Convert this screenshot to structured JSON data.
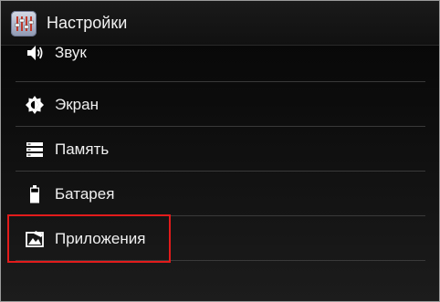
{
  "header": {
    "app_icon": "settings-equalizer-icon",
    "title": "Настройки"
  },
  "settings_list": [
    {
      "label": "Звук",
      "icon": "volume-speaker-icon"
    },
    {
      "label": "Экран",
      "icon": "brightness-icon"
    },
    {
      "label": "Память",
      "icon": "storage-icon"
    },
    {
      "label": "Батарея",
      "icon": "battery-icon"
    },
    {
      "label": "Приложения",
      "icon": "applications-icon"
    }
  ],
  "colors": {
    "background": "#000000",
    "text": "#f0f0f0",
    "divider": "#3a3a3a",
    "highlight": "#e21b1b"
  }
}
